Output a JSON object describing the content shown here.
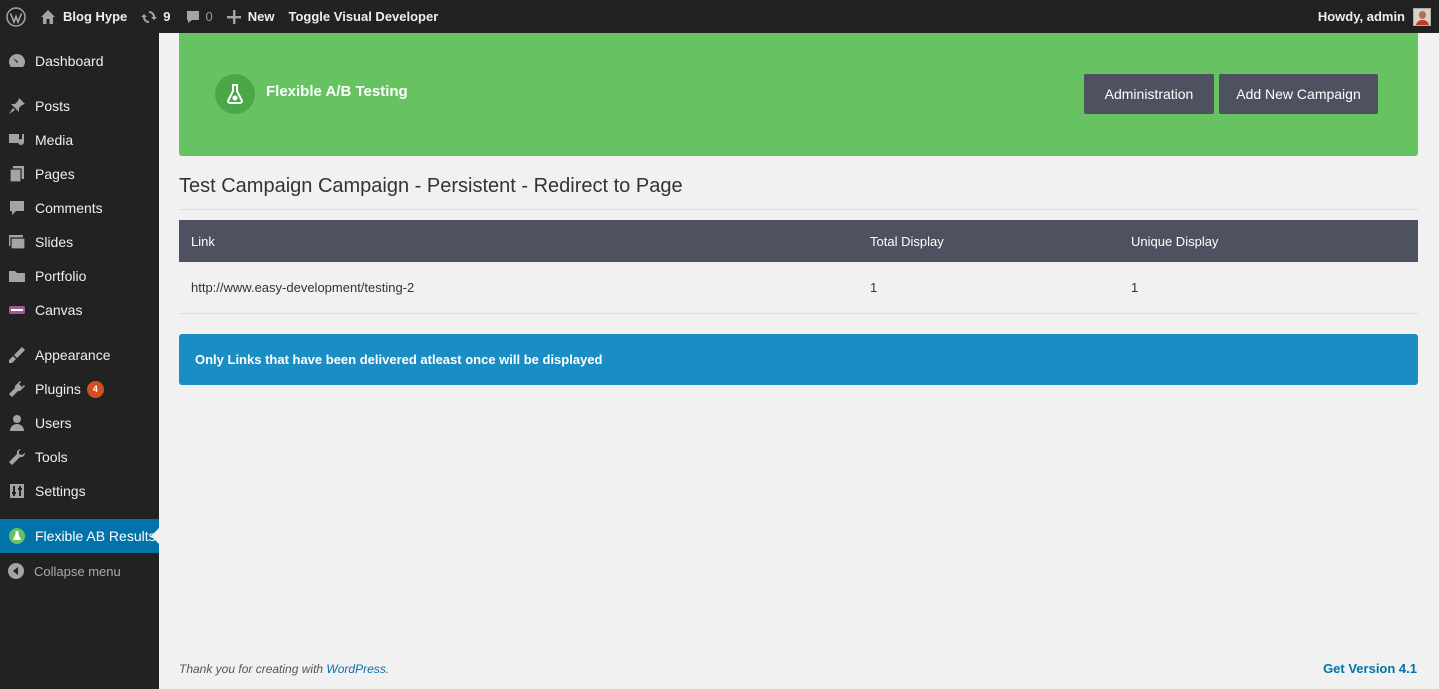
{
  "adminbar": {
    "site_name": "Blog Hype",
    "updates_count": "9",
    "comments_count": "0",
    "new_label": "New",
    "toggle_label": "Toggle Visual Developer",
    "howdy": "Howdy, admin"
  },
  "sidebar": {
    "items": [
      {
        "label": "Dashboard",
        "icon": "dashboard-icon"
      },
      {
        "label": "Posts",
        "icon": "pin-icon"
      },
      {
        "label": "Media",
        "icon": "media-icon"
      },
      {
        "label": "Pages",
        "icon": "pages-icon"
      },
      {
        "label": "Comments",
        "icon": "comment-icon"
      },
      {
        "label": "Slides",
        "icon": "slides-icon"
      },
      {
        "label": "Portfolio",
        "icon": "folder-icon"
      },
      {
        "label": "Canvas",
        "icon": "woo-icon"
      },
      {
        "label": "Appearance",
        "icon": "brush-icon"
      },
      {
        "label": "Plugins",
        "icon": "plug-icon",
        "badge": "4"
      },
      {
        "label": "Users",
        "icon": "user-icon"
      },
      {
        "label": "Tools",
        "icon": "wrench-icon"
      },
      {
        "label": "Settings",
        "icon": "settings-icon"
      },
      {
        "label": "Flexible AB Results",
        "icon": "flask-icon",
        "active": true
      }
    ],
    "collapse_label": "Collapse menu"
  },
  "banner": {
    "title": "Flexible A/B Testing",
    "admin_button": "Administration",
    "add_button": "Add New Campaign",
    "color": "#67c262"
  },
  "main": {
    "title": "Test Campaign Campaign - Persistent - Redirect to Page",
    "table": {
      "headers": [
        "Link",
        "Total Display",
        "Unique Display"
      ],
      "rows": [
        [
          "http://www.easy-development/testing-2",
          "1",
          "1"
        ]
      ]
    },
    "notice": "Only Links that have been delivered atleast once will be displayed"
  },
  "footer": {
    "thanks_prefix": "Thank you for creating with",
    "wordpress_link": "WordPress",
    "thanks_suffix": ".",
    "version_link": "Get Version 4.1"
  }
}
